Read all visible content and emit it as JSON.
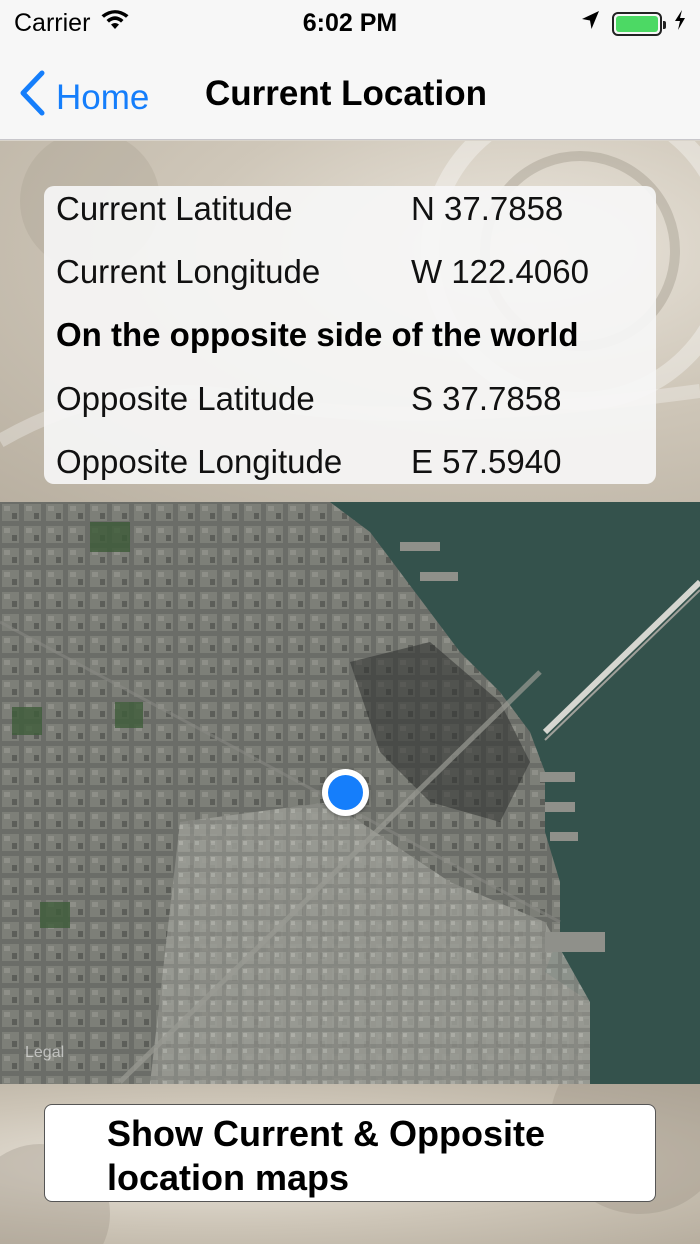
{
  "status_bar": {
    "carrier": "Carrier",
    "time": "6:02 PM",
    "wifi_icon": "wifi-icon",
    "location_icon": "location-arrow-icon",
    "battery_icon": "battery-icon",
    "charging_icon": "bolt-icon"
  },
  "nav": {
    "back_label": "Home",
    "title": "Current Location"
  },
  "info": {
    "current_latitude_label": "Current Latitude",
    "current_latitude_value": "N 37.7858",
    "current_longitude_label": "Current Longitude",
    "current_longitude_value": "W 122.4060",
    "opposite_heading": "On the opposite side of the world",
    "opposite_latitude_label": "Opposite Latitude",
    "opposite_latitude_value": "S 37.7858",
    "opposite_longitude_label": "Opposite Longitude",
    "opposite_longitude_value": "E 57.5940"
  },
  "map": {
    "legal": "Legal"
  },
  "button": {
    "label": "Show Current & Opposite location maps"
  },
  "colors": {
    "accent": "#157efb",
    "battery": "#4cd964"
  }
}
